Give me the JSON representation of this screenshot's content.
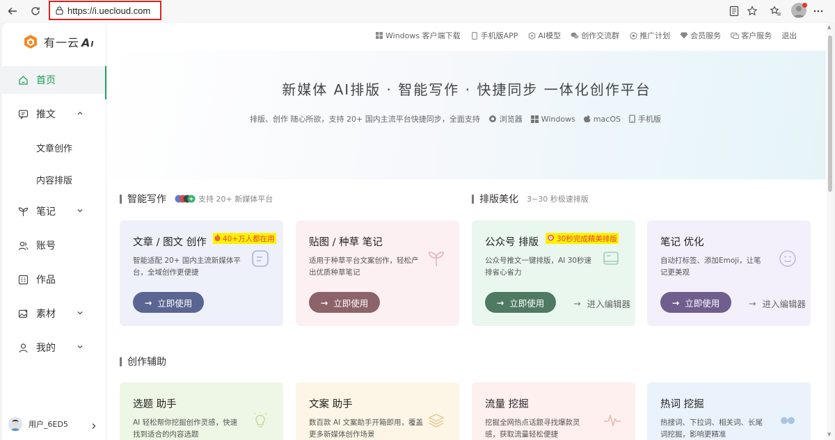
{
  "browser": {
    "url": "https://i.uecloud.com"
  },
  "logo": {
    "text": "有一云"
  },
  "sidebar": {
    "items": [
      {
        "label": "首页",
        "icon": "home-icon"
      },
      {
        "label": "推文",
        "icon": "message-icon"
      },
      {
        "label": "笔记",
        "icon": "sprout-icon"
      },
      {
        "label": "账号",
        "icon": "users-icon"
      },
      {
        "label": "作品",
        "icon": "grid-icon"
      },
      {
        "label": "素材",
        "icon": "image-icon"
      },
      {
        "label": "我的",
        "icon": "user-icon"
      }
    ],
    "sub_items": [
      "文章创作",
      "内容排版"
    ],
    "user": "用户_6ED5"
  },
  "top_links": [
    {
      "label": "Windows 客户端下载",
      "icon": "windows-icon"
    },
    {
      "label": "手机版APP",
      "icon": "phone-icon"
    },
    {
      "label": "AI模型",
      "icon": "ai-model-icon"
    },
    {
      "label": "创作交流群",
      "icon": "chat-icon"
    },
    {
      "label": "推广计划",
      "icon": "promote-icon"
    },
    {
      "label": "会员服务",
      "icon": "diamond-icon"
    },
    {
      "label": "客户服务",
      "icon": "service-icon"
    },
    {
      "label": "退出",
      "icon": ""
    }
  ],
  "hero": {
    "title": "新媒体 AI排版 · 智能写作 · 快捷同步 一体化创作平台",
    "subtitle": "排版、创作 随心所欲，支持 20+ 国内主流平台快捷同步，全面支持",
    "platforms": [
      "浏览器",
      "Windows",
      "macOS",
      "手机版"
    ]
  },
  "sections": {
    "writing": {
      "title": "智能写作",
      "note": "支持 20+ 新媒体平台"
    },
    "layout": {
      "title": "排版美化",
      "note": "3~30 秒极速排版"
    },
    "assist": {
      "title": "创作辅助"
    }
  },
  "cards": [
    {
      "title": "文章 / 图文 创作",
      "badge": "40+万人都在用",
      "desc": "智能适配 20+ 国内主流新媒体平台，全域创作更便捷",
      "button": "立即使用",
      "bg": "#eef1fa",
      "btn": "#5a6592"
    },
    {
      "title": "贴图 / 种草 笔记",
      "badge": "",
      "desc": "适用于种草平台文案创作，轻松产出优质种草笔记",
      "button": "立即使用",
      "bg": "#fdf0f2",
      "btn": "#8c6368"
    },
    {
      "title": "公众号 排版",
      "badge": "30秒完成精美排版",
      "desc": "公众号推文一键排版，AI 30秒速排省心省力",
      "button": "立即使用",
      "link": "进入编辑器",
      "bg": "#eaf7ef",
      "btn": "#4f7a62"
    },
    {
      "title": "笔记 优化",
      "badge": "",
      "desc": "自动打标签、添加Emoji，让笔记更美观",
      "button": "立即使用",
      "link": "进入编辑器",
      "bg": "#f3f0fb",
      "btn": "#6f5e8e"
    }
  ],
  "assist_cards": [
    {
      "title": "选题 助手",
      "desc": "AI 轻松帮你挖掘创作灵感，快速找到适合的内容选题",
      "bg": "#eef7e6"
    },
    {
      "title": "文案 助手",
      "desc": "数百款 AI 文案助手开箱即用，覆盖更多新媒体创作场景",
      "bg": "#fdf6e6"
    },
    {
      "title": "流量 挖掘",
      "desc": "挖掘全网热点话题寻找爆款灵感，获取流量轻松便捷",
      "bg": "#fdf0ee"
    },
    {
      "title": "热词 挖掘",
      "desc": "热搜词、下拉词、相关词、长尾词挖掘，影响更精准",
      "bg": "#eaf3fb"
    }
  ],
  "colors": {
    "accent": "#18a058",
    "badge_bg": "#fff200",
    "badge_text": "#e8423b",
    "highlight_border": "#d9231f"
  }
}
